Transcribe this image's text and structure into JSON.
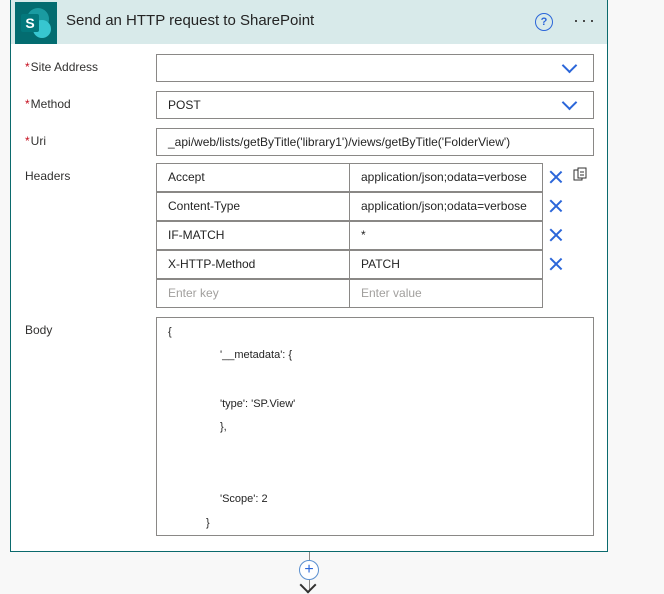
{
  "card": {
    "title": "Send an HTTP request to SharePoint",
    "help_glyph": "?",
    "more_glyph": "···",
    "logo_letter": "S",
    "icons": {
      "logo": "sharepoint-logo",
      "help": "help-icon",
      "more": "more-icon"
    },
    "accent_color": "#0b6a6d"
  },
  "fields": {
    "site_address": {
      "label": "Site Address",
      "required_mark": "*",
      "value": ""
    },
    "method": {
      "label": "Method",
      "required_mark": "*",
      "value": "POST"
    },
    "uri": {
      "label": "Uri",
      "required_mark": "*",
      "value": "_api/web/lists/getByTitle('library1')/views/getByTitle('FolderView')"
    },
    "headers": {
      "label": "Headers",
      "rows": [
        {
          "key": "Accept",
          "value": "application/json;odata=verbose"
        },
        {
          "key": "Content-Type",
          "value": "application/json;odata=verbose"
        },
        {
          "key": "IF-MATCH",
          "value": "*"
        },
        {
          "key": "X-HTTP-Method",
          "value": "PATCH"
        }
      ],
      "key_placeholder": "Enter key",
      "value_placeholder": "Enter value"
    },
    "body": {
      "label": "Body",
      "lines": [
        "{",
        "'__metadata': {",
        "'type': 'SP.View'",
        "},",
        "'Scope': 2",
        "}"
      ]
    }
  },
  "connector": {
    "plus_glyph": "+"
  }
}
